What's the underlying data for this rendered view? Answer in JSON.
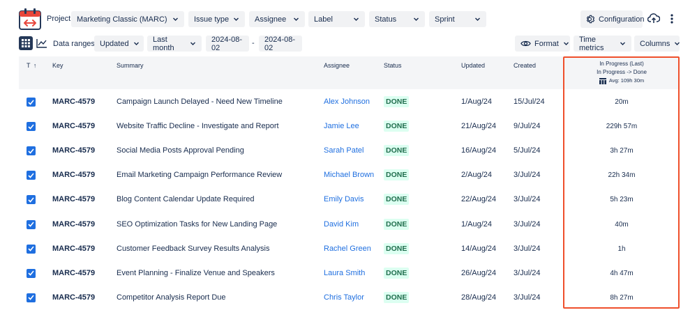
{
  "filters": {
    "project_label": "Project:",
    "project_value": "Marketing Classic (MARC)",
    "issue_type": "Issue type",
    "assignee": "Assignee",
    "label": "Label",
    "status": "Status",
    "sprint": "Sprint"
  },
  "toolbar": {
    "configuration": "Configuration",
    "data_ranges_label": "Data ranges:",
    "date_field": "Updated",
    "period": "Last month",
    "date_from": "2024-08-02",
    "date_sep": "-",
    "date_to": "2024-08-02",
    "format": "Format",
    "time_metrics": "Time metrics",
    "columns": "Columns"
  },
  "columns": {
    "type": "T",
    "key": "Key",
    "summary": "Summary",
    "assignee": "Assignee",
    "status": "Status",
    "updated": "Updated",
    "created": "Created",
    "metric_title": "In Progress (Last)",
    "metric_subtitle": "In Progress -> Done",
    "metric_avg": "Avg: 109h 30m"
  },
  "rows": [
    {
      "key": "MARC-4579",
      "summary": "Campaign Launch Delayed - Need New Timeline",
      "assignee": "Alex Johnson",
      "status": "DONE",
      "updated": "1/Aug/24",
      "created": "15/Jul/24",
      "metric": "20m"
    },
    {
      "key": "MARC-4579",
      "summary": "Website Traffic Decline - Investigate and Report",
      "assignee": "Jamie Lee",
      "status": "DONE",
      "updated": "21/Aug/24",
      "created": "9/Jul/24",
      "metric": "229h 57m"
    },
    {
      "key": "MARC-4579",
      "summary": "Social Media Posts Approval Pending",
      "assignee": "Sarah Patel",
      "status": "DONE",
      "updated": "16/Aug/24",
      "created": "5/Jul/24",
      "metric": "3h 27m"
    },
    {
      "key": "MARC-4579",
      "summary": "Email Marketing Campaign Performance Review",
      "assignee": "Michael Brown",
      "status": "DONE",
      "updated": "2/Aug/24",
      "created": "3/Jul/24",
      "metric": "22h 34m"
    },
    {
      "key": "MARC-4579",
      "summary": "Blog Content Calendar Update Required",
      "assignee": "Emily Davis",
      "status": "DONE",
      "updated": "22/Aug/24",
      "created": "3/Jul/24",
      "metric": "5h 23m"
    },
    {
      "key": "MARC-4579",
      "summary": "SEO Optimization Tasks for New Landing Page",
      "assignee": "David Kim",
      "status": "DONE",
      "updated": "1/Aug/24",
      "created": "3/Jul/24",
      "metric": "40m"
    },
    {
      "key": "MARC-4579",
      "summary": "Customer Feedback Survey Results Analysis",
      "assignee": "Rachel Green",
      "status": "DONE",
      "updated": "14/Aug/24",
      "created": "3/Jul/24",
      "metric": "1h"
    },
    {
      "key": "MARC-4579",
      "summary": "Event Planning - Finalize Venue and Speakers",
      "assignee": "Laura Smith",
      "status": "DONE",
      "updated": "26/Aug/24",
      "created": "3/Jul/24",
      "metric": "4h 47m"
    },
    {
      "key": "MARC-4579",
      "summary": "Competitor Analysis Report Due",
      "assignee": "Chris Taylor",
      "status": "DONE",
      "updated": "28/Aug/24",
      "created": "3/Jul/24",
      "metric": "8h 27m"
    }
  ],
  "colors": {
    "accent": "#1f6fe0",
    "status_done_bg": "#dcfff1",
    "status_done_text": "#216e4e",
    "highlight": "#ef4f2b",
    "logo_red": "#e8463b"
  }
}
